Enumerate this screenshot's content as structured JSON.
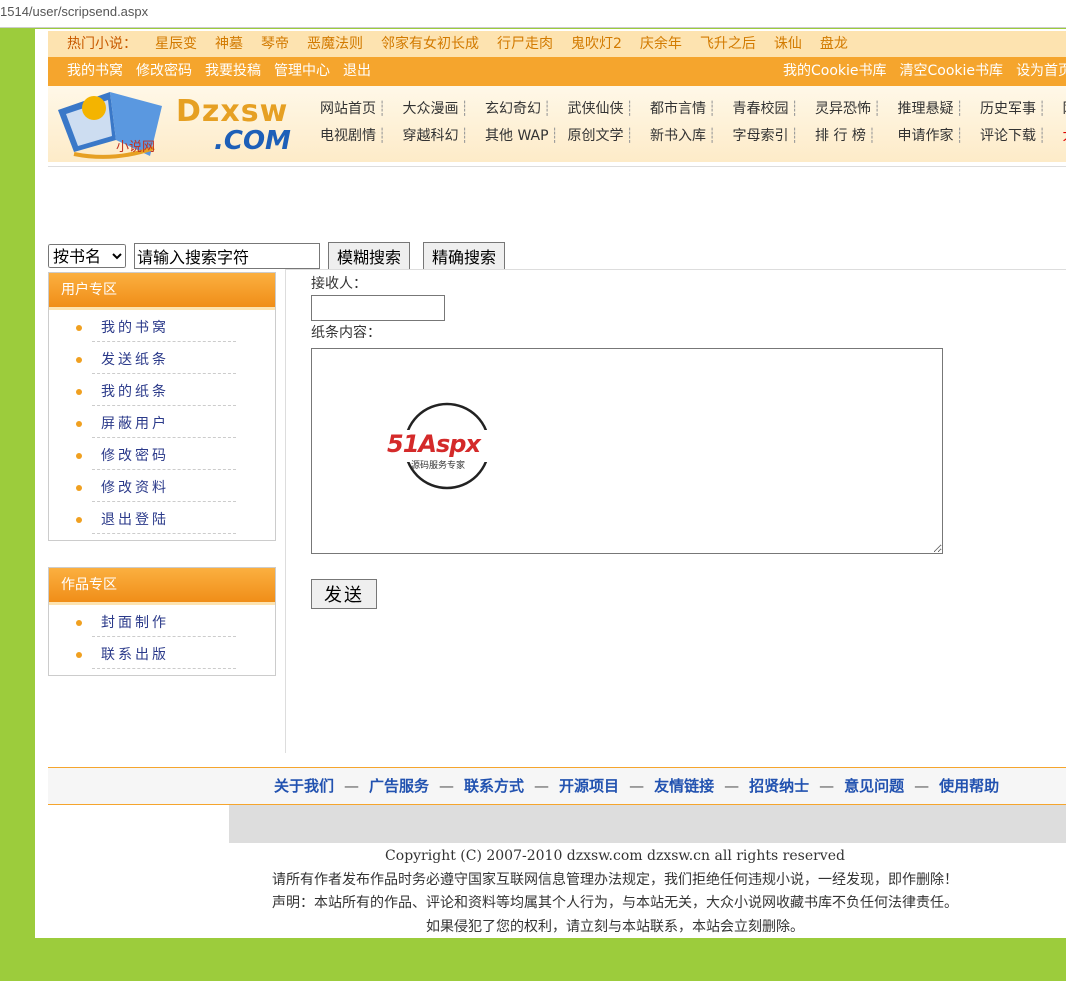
{
  "browser": {
    "url": "1514/user/scripsend.aspx"
  },
  "hot": {
    "label": "热门小说：",
    "items": [
      "星辰变",
      "神墓",
      "琴帝",
      "恶魔法则",
      "邻家有女初长成",
      "行尸走肉",
      "鬼吹灯2",
      "庆余年",
      "飞升之后",
      "诛仙",
      "盘龙"
    ]
  },
  "topnav": {
    "left": [
      "我的书窝",
      "修改密码",
      "我要投稿",
      "管理中心",
      "退出"
    ],
    "right": [
      "我的Cookie书库",
      "清空Cookie书库",
      "设为首页"
    ]
  },
  "logo": {
    "text1": "Dzxsw",
    "text2": ".COM",
    "small": "小说网"
  },
  "mainnav": {
    "row1": [
      "网站首页",
      "大众漫画",
      "玄幻奇幻",
      "武侠仙侠",
      "都市言情",
      "青春校园",
      "灵异恐怖",
      "推理悬疑",
      "历史军事",
      "网游"
    ],
    "row2": [
      "电视剧情",
      "穿越科幻",
      "其他 WAP",
      "原创文学",
      "新书入库",
      "字母索引",
      "排 行 榜",
      "申请作家",
      "评论下载",
      "大"
    ]
  },
  "search": {
    "select_value": "按书名",
    "input_value": "请输入搜索字符",
    "fuzzy_label": "模糊搜索",
    "exact_label": "精确搜索"
  },
  "user_box": {
    "title": "用户专区",
    "items": [
      "我的书窝",
      "发送纸条",
      "我的纸条",
      "屏蔽用户",
      "修改密码",
      "修改资料",
      "退出登陆"
    ]
  },
  "works_box": {
    "title": "作品专区",
    "items": [
      "封面制作",
      "联系出版"
    ]
  },
  "form": {
    "receiver_label": "接收人：",
    "receiver_value": "",
    "content_label": "纸条内容：",
    "content_value": "",
    "send_label": "发送",
    "watermark_text": "51Aspx",
    "watermark_sub": "源码服务专家"
  },
  "footer": {
    "links": [
      "关于我们",
      "广告服务",
      "联系方式",
      "开源项目",
      "友情链接",
      "招贤纳士",
      "意见问题",
      "使用帮助"
    ],
    "separator": "—",
    "copyright": "Copyright (C) 2007-2010 dzxsw.com dzxsw.cn all rights reserved",
    "notice1": "请所有作者发布作品时务必遵守国家互联网信息管理办法规定，我们拒绝任何违规小说，一经发现，即作删除！",
    "notice2": "声明：本站所有的作品、评论和资料等均属其个人行为，与本站无关，大众小说网收藏书库不负任何法律责任。",
    "notice3": "如果侵犯了您的权利，请立刻与本站联系，本站会立刻删除。"
  },
  "colors": {
    "page_bg": "#9ccc3c",
    "orange": "#f5a52d",
    "link_blue": "#2252b0"
  }
}
